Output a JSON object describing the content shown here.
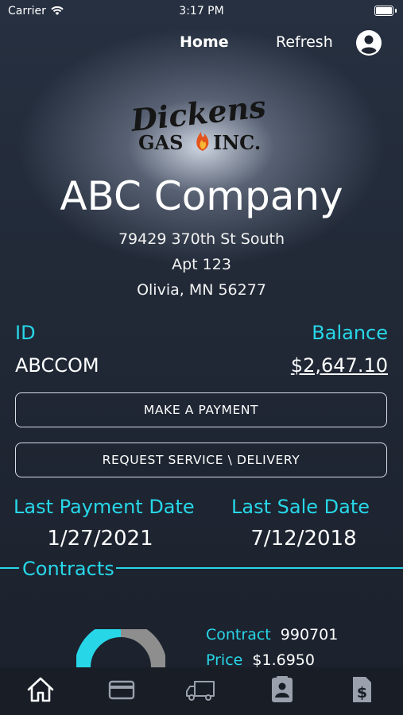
{
  "status_bar": {
    "carrier": "Carrier",
    "time": "3:17 PM"
  },
  "nav": {
    "home": "Home",
    "refresh": "Refresh",
    "profile_icon": "user-circle-icon"
  },
  "logo": {
    "line1": "Dickens",
    "line2_left": "GAS",
    "line2_right": "INC."
  },
  "customer": {
    "company": "ABC Company",
    "address_line1": "79429 370th St South",
    "address_line2": "Apt 123",
    "address_line3": "Olivia, MN 56277",
    "id_label": "ID",
    "id_value": "ABCCOM",
    "balance_label": "Balance",
    "balance_value": "$2,647.10"
  },
  "buttons": {
    "payment": "MAKE A PAYMENT",
    "service": "REQUEST SERVICE \\ DELIVERY"
  },
  "dates": {
    "last_payment_label": "Last Payment Date",
    "last_payment_value": "1/27/2021",
    "last_sale_label": "Last Sale Date",
    "last_sale_value": "7/12/2018"
  },
  "contracts": {
    "title": "Contracts",
    "contract_label": "Contract",
    "contract_value": "990701",
    "price_label": "Price",
    "price_value": "$1.6950",
    "gauge_fill_fraction": 0.5
  },
  "tabs": [
    "home-icon",
    "credit-card-icon",
    "truck-icon",
    "contact-card-icon",
    "invoice-dollar-icon"
  ],
  "colors": {
    "accent": "#27d7e8",
    "background": "#1f2531",
    "tabbar": "#181d26"
  }
}
